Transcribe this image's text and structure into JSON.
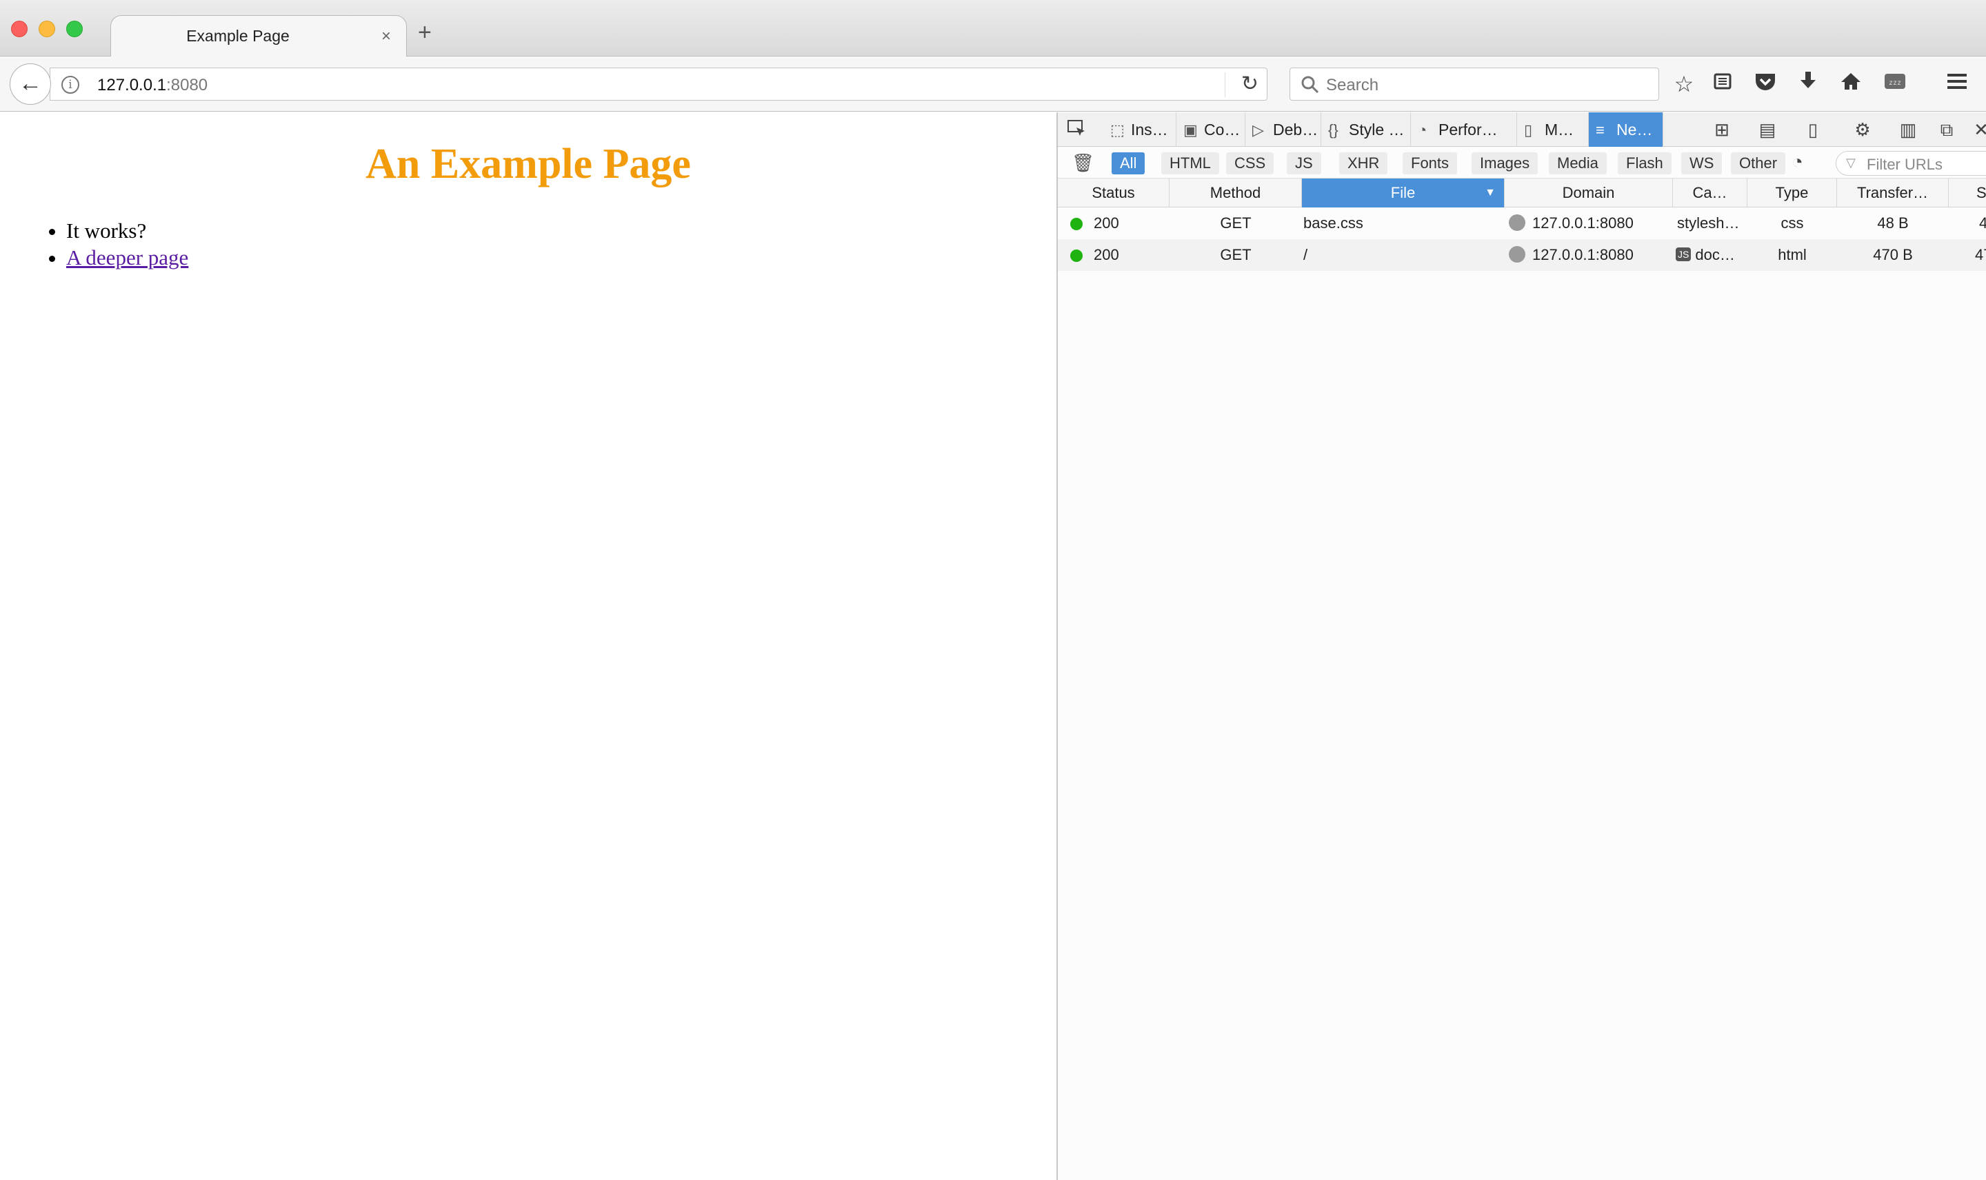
{
  "browser": {
    "tab": {
      "title": "Example Page",
      "close_glyph": "×"
    },
    "new_tab_glyph": "+",
    "url": {
      "host": "127.0.0.1",
      "port": ":8080"
    },
    "search": {
      "placeholder": "Search"
    }
  },
  "page": {
    "heading": "An Example Page",
    "heading_color": "#f29b0b",
    "items": [
      {
        "text": "It works?"
      },
      {
        "text": "A deeper page"
      }
    ]
  },
  "devtools": {
    "tabs": [
      {
        "label": "Ins…",
        "icon": "inspector-icon"
      },
      {
        "label": "Co…",
        "icon": "console-icon"
      },
      {
        "label": "Deb…",
        "icon": "debugger-icon"
      },
      {
        "label": "Style …",
        "icon": "style-editor-icon"
      },
      {
        "label": "Perfor…",
        "icon": "performance-icon"
      },
      {
        "label": "M…",
        "icon": "memory-icon"
      },
      {
        "label": "Ne…",
        "icon": "network-icon",
        "active": true
      }
    ],
    "filters": [
      "All",
      "HTML",
      "CSS",
      "JS",
      "XHR",
      "Fonts",
      "Images",
      "Media",
      "Flash",
      "WS",
      "Other"
    ],
    "active_filter": "All",
    "filter_urls_placeholder": "Filter URLs",
    "columns": [
      "Status",
      "Method",
      "File",
      "Domain",
      "Ca…",
      "Type",
      "Transfer…",
      "Si"
    ],
    "sorted_column": "File",
    "rows": [
      {
        "status": "200",
        "method": "GET",
        "file": "base.css",
        "domain": "127.0.0.1:8080",
        "cause": "stylesh…",
        "type": "css",
        "transferred": "48 B",
        "size": "4"
      },
      {
        "status": "200",
        "method": "GET",
        "file": "/",
        "domain": "127.0.0.1:8080",
        "cause_badge": "JS",
        "cause": "doc…",
        "type": "html",
        "transferred": "470 B",
        "size": "47"
      }
    ],
    "accent_color": "#4a90d9",
    "status_ok_color": "#1fb312"
  }
}
